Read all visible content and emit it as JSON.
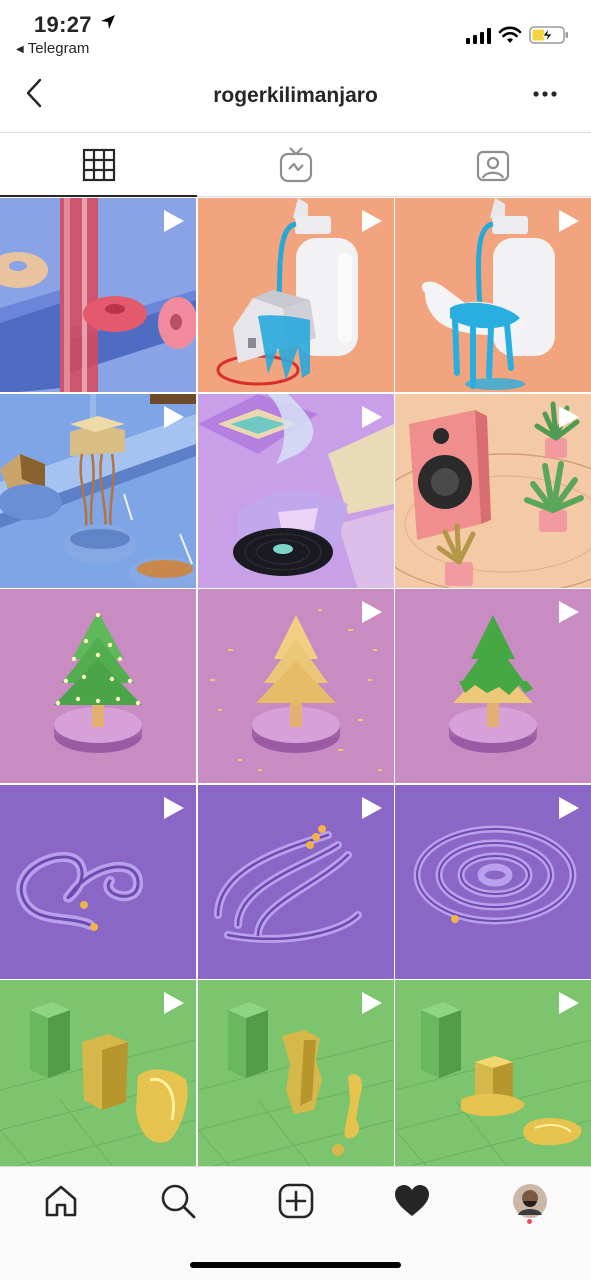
{
  "status": {
    "time": "19:27",
    "back_app": "Telegram"
  },
  "nav": {
    "title": "rogerkilimanjaro"
  },
  "tabs": [
    {
      "name": "posts-grid",
      "icon": "grid-icon",
      "active": true
    },
    {
      "name": "igtv",
      "icon": "igtv-icon",
      "active": false
    },
    {
      "name": "tagged",
      "icon": "tagged-person-icon",
      "active": false
    }
  ],
  "grid": [
    {
      "scene": "donut-tray",
      "video": true
    },
    {
      "scene": "soap-house",
      "video": true
    },
    {
      "scene": "soap-hand",
      "video": true
    },
    {
      "scene": "noodle-conveyor",
      "video": true
    },
    {
      "scene": "vinyl-record",
      "video": true
    },
    {
      "scene": "speaker-plants",
      "video": true
    },
    {
      "scene": "tree-lights",
      "video": false
    },
    {
      "scene": "tree-wood",
      "video": true
    },
    {
      "scene": "tree-melting",
      "video": true
    },
    {
      "scene": "sand-squiggle",
      "video": true
    },
    {
      "scene": "sand-waves",
      "video": true
    },
    {
      "scene": "sand-spiral",
      "video": true
    },
    {
      "scene": "gold-blocks-1",
      "video": true
    },
    {
      "scene": "gold-blocks-2",
      "video": true
    },
    {
      "scene": "gold-blocks-3",
      "video": true
    }
  ],
  "bottom_nav": [
    {
      "name": "home",
      "icon": "home-icon"
    },
    {
      "name": "search",
      "icon": "search-icon"
    },
    {
      "name": "new-post",
      "icon": "add-post-icon"
    },
    {
      "name": "activity",
      "icon": "heart-icon"
    },
    {
      "name": "profile",
      "icon": "profile-avatar"
    }
  ],
  "colors": {
    "text": "#262626",
    "divider": "#dbdbdb",
    "notification_dot": "#ed4956"
  }
}
